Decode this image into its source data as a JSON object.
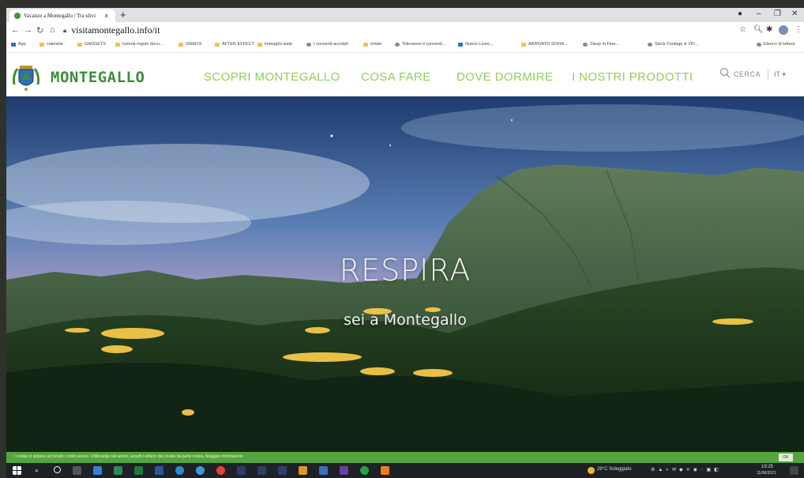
{
  "browser": {
    "tab_title": "Vacanze a Montegallo | Tra ulivi",
    "tab_close": "×",
    "new_tab": "+",
    "url": "visitamontegallo.info/it",
    "bookmarks": [
      "App",
      "calendar",
      "GADGETS",
      "tutorial regole docu...",
      "GRAFIX",
      "AFTER EFFECT",
      "immagini slate",
      "I consenti accolati",
      "riviste",
      "Televisore il consenti...",
      "Nuovo Liceo...",
      "ARRIVATO SOFIA...",
      "Sleep in Fine...",
      "Stock Footage & VFI...",
      "Elenco di lettura"
    ]
  },
  "site": {
    "brand": "MONTEGALLO",
    "nav": [
      "SCOPRI MONTEGALLO",
      "COSA FARE",
      "DOVE DORMIRE",
      "I NOSTRI PRODOTTI"
    ],
    "search_label": "CERCA",
    "lang": "IT ▾",
    "hero_title": "RESPIRA",
    "hero_subtitle": "sei a Montegallo",
    "cookie_text": "I cookie ci aiutano ad fornirti i nostri servizi. Utilizzando tali servizi, accetti l'utilizzo dei cookie da parte nostra. Maggiori informazioni",
    "cookie_ok": "OK"
  },
  "taskbar": {
    "weather": "29°C Soleggiato",
    "time": "19:25",
    "date": "11/06/2021"
  },
  "colors": {
    "brand_green": "#3e8e3a",
    "nav_green": "#8ed05a",
    "cookie_green": "#56a43c"
  }
}
